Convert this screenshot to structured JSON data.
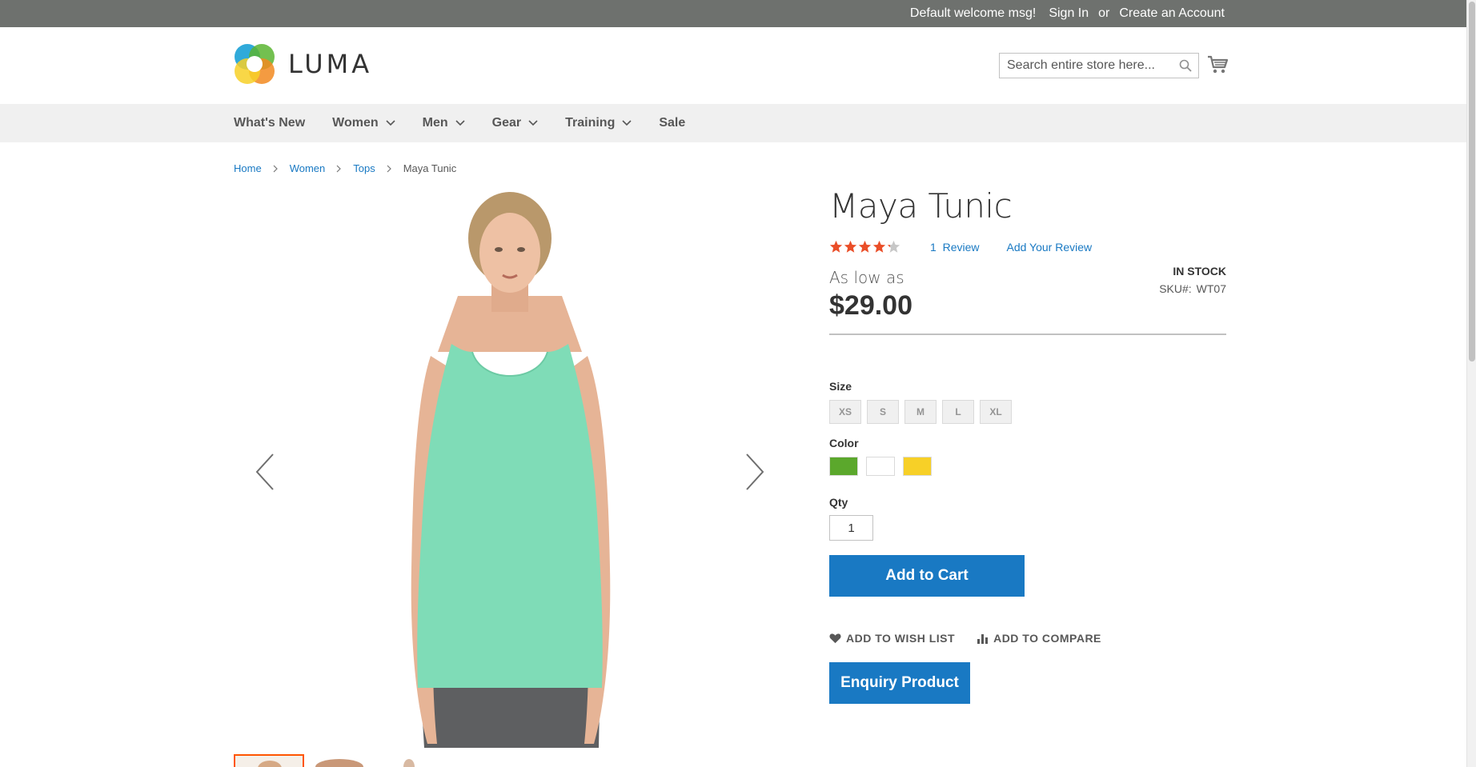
{
  "topbar": {
    "welcome": "Default welcome msg!",
    "sign_in": "Sign In",
    "or": "or",
    "create_account": "Create an Account"
  },
  "header": {
    "logo_text": "LUMA",
    "search_placeholder": "Search entire store here..."
  },
  "nav": {
    "items": [
      {
        "label": "What's New",
        "has_dropdown": false
      },
      {
        "label": "Women",
        "has_dropdown": true
      },
      {
        "label": "Men",
        "has_dropdown": true
      },
      {
        "label": "Gear",
        "has_dropdown": true
      },
      {
        "label": "Training",
        "has_dropdown": true
      },
      {
        "label": "Sale",
        "has_dropdown": false
      }
    ]
  },
  "breadcrumb": {
    "home": "Home",
    "women": "Women",
    "tops": "Tops",
    "current": "Maya Tunic"
  },
  "product": {
    "title": "Maya Tunic",
    "rating": 4.2,
    "rating_max": 5,
    "review_count": "1",
    "review_label": "Review",
    "add_review": "Add Your Review",
    "as_low_as": "As low as",
    "price": "$29.00",
    "stock_status": "In stock",
    "sku_label": "SKU#:",
    "sku": "WT07",
    "size_label": "Size",
    "sizes": [
      "XS",
      "S",
      "M",
      "L",
      "XL"
    ],
    "color_label": "Color",
    "colors": [
      "#5ba82c",
      "#ffffff",
      "#f7d027"
    ],
    "qty_label": "Qty",
    "qty": "1",
    "add_to_cart": "Add to Cart",
    "add_to_wishlist": "ADD TO WISH LIST",
    "add_to_compare": "ADD TO COMPARE",
    "enquiry": "Enquiry Product"
  },
  "icons": {
    "search": "search-icon",
    "cart": "cart-icon",
    "prev": "chevron-left-icon",
    "next": "chevron-right-icon",
    "wishlist": "heart-icon",
    "compare": "bar-chart-icon"
  },
  "colors": {
    "accent": "#1979c3",
    "topbar": "#6e716e",
    "star": "#ff5501",
    "nav_bg": "#f0f0f0"
  }
}
